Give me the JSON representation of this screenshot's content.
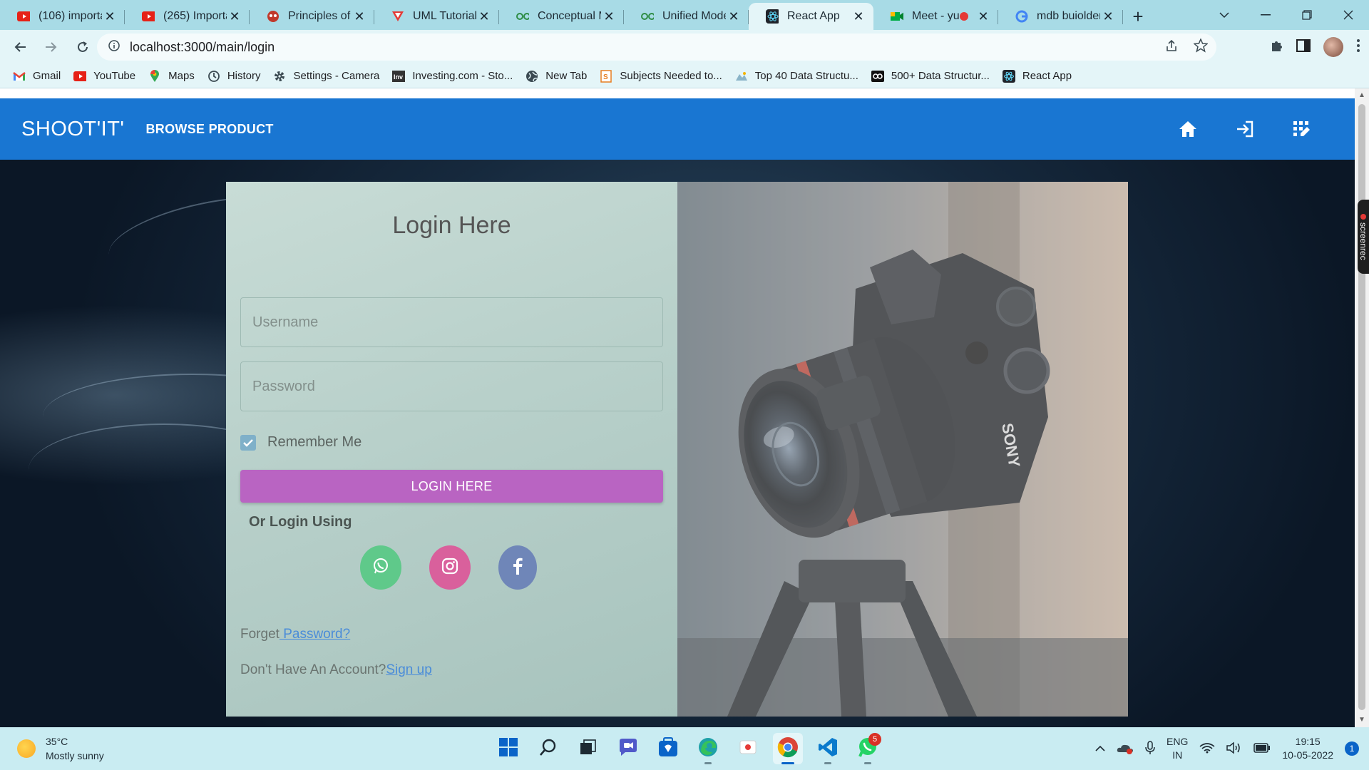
{
  "browser": {
    "tabs": [
      {
        "title": "(106) importan",
        "icon": "youtube-icon"
      },
      {
        "title": "(265) Importan",
        "icon": "youtube-icon"
      },
      {
        "title": "Principles of M",
        "icon": "app-icon"
      },
      {
        "title": "UML Tutorial -",
        "icon": "v-icon"
      },
      {
        "title": "Conceptual M",
        "icon": "gfg-icon"
      },
      {
        "title": "Unified Model",
        "icon": "gfg-icon"
      },
      {
        "title": "React App",
        "icon": "react-icon",
        "active": true
      },
      {
        "title": "Meet - yu",
        "icon": "meet-icon",
        "recording": true
      },
      {
        "title": "mdb buiolder",
        "icon": "google-icon"
      }
    ],
    "url": "localhost:3000/main/login",
    "bookmarks": [
      {
        "label": "Gmail",
        "icon": "gmail-icon"
      },
      {
        "label": "YouTube",
        "icon": "youtube-icon"
      },
      {
        "label": "Maps",
        "icon": "maps-icon"
      },
      {
        "label": "History",
        "icon": "history-icon"
      },
      {
        "label": "Settings - Camera",
        "icon": "gear-icon"
      },
      {
        "label": "Investing.com - Sto...",
        "icon": "investing-icon"
      },
      {
        "label": "New Tab",
        "icon": "globe-icon"
      },
      {
        "label": "Subjects Needed to...",
        "icon": "doc-icon"
      },
      {
        "label": "Top 40 Data Structu...",
        "icon": "site-icon"
      },
      {
        "label": "500+ Data Structur...",
        "icon": "gfg-icon"
      },
      {
        "label": "React App",
        "icon": "react-icon"
      }
    ]
  },
  "navbar": {
    "brand": "SHOOT'IT'",
    "link": "BROWSE PRODUCT",
    "icons": [
      "home-icon",
      "login-icon",
      "apps-edit-icon"
    ]
  },
  "login": {
    "heading": "Login Here",
    "username_placeholder": "Username",
    "password_placeholder": "Password",
    "remember_label": "Remember Me",
    "remember_checked": true,
    "button_label": "LOGIN HERE",
    "or_login": "Or Login Using",
    "socials": [
      {
        "name": "whatsapp",
        "color": "#5fc98a"
      },
      {
        "name": "instagram",
        "color": "#d9609c"
      },
      {
        "name": "facebook",
        "color": "#6f86b8"
      }
    ],
    "forget_prefix": "Forget",
    "forget_link": " Password?",
    "signup_prefix": "Don't Have An Account?",
    "signup_link": "Sign up"
  },
  "colors": {
    "navbar": "#1976d2",
    "login_button": "#b964c2",
    "link": "#4a8cd9"
  },
  "taskbar": {
    "weather_temp": "35°C",
    "weather_desc": "Mostly sunny",
    "lang_line1": "ENG",
    "lang_line2": "IN",
    "time": "19:15",
    "date": "10-05-2022",
    "notifications": "1",
    "whatsapp_badge": "5"
  },
  "screenrec_label": "screenrec"
}
